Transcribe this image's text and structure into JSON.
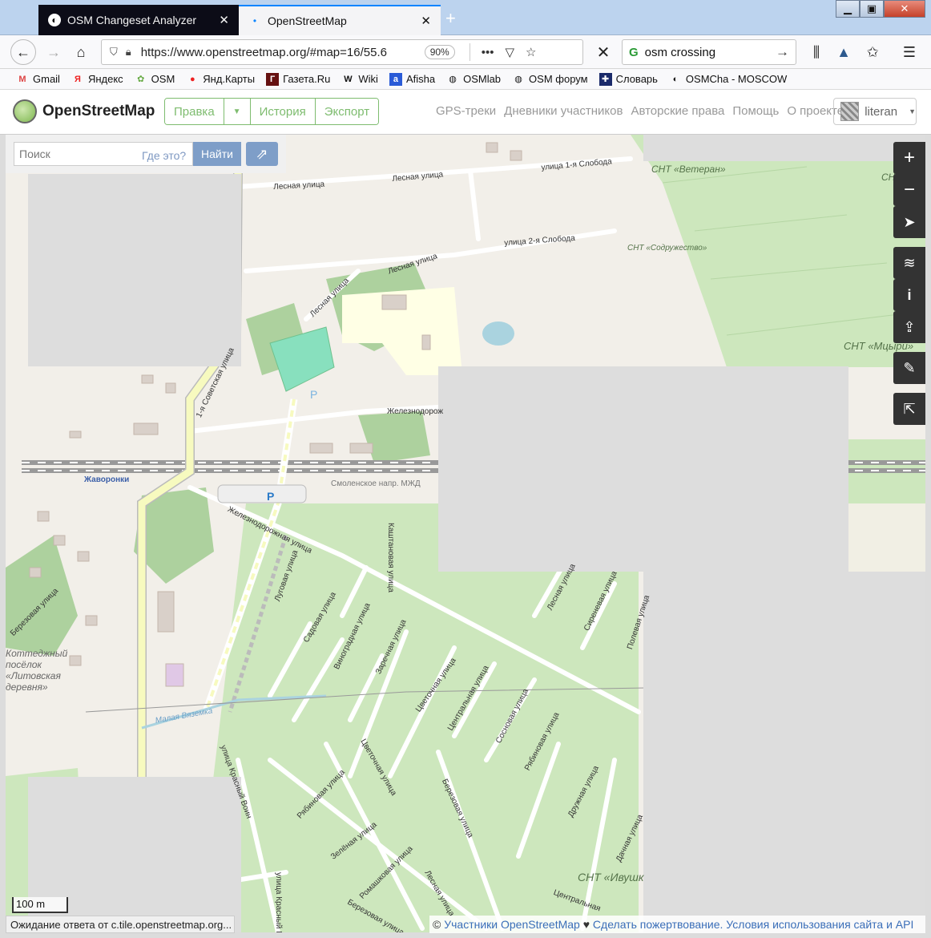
{
  "browser": {
    "tabs": [
      {
        "title": "OSM Changeset Analyzer",
        "active": false
      },
      {
        "title": "OpenStreetMap",
        "active": true
      }
    ],
    "new_tab_symbol": "+",
    "url": "https://www.openstreetmap.org/#map=16/55.6",
    "zoom": "90%",
    "search_query": "osm crossing",
    "bookmarks": [
      "Gmail",
      "Яндекс",
      "OSM",
      "Янд.Карты",
      "Газета.Ru",
      "Wiki",
      "Afisha",
      "OSMlab",
      "OSM форум",
      "Словарь",
      "OSMCha - MOSCOW"
    ]
  },
  "osm": {
    "site_name": "OpenStreetMap",
    "edit_label": "Правка",
    "history_label": "История",
    "export_label": "Экспорт",
    "nav_links": [
      "GPS-треки",
      "Дневники участников",
      "Авторские права",
      "Помощь",
      "О проекте"
    ],
    "username": "literan",
    "search_placeholder": "Поиск",
    "where_is": "Где это?",
    "find_button": "Найти"
  },
  "map": {
    "labels": {
      "lesnaya1": "Лесная улица",
      "lesnaya2": "Лесная улица",
      "lesnaya3": "Лесная улица",
      "lesnaya4": "Лесная улица",
      "sloboda1": "улица 1-я Слобода",
      "sloboda2": "улица 2-я Слобода",
      "snt_veteran": "СНТ «Ветеран»",
      "snt_yu": "СНТ «Юб",
      "snt_sodr": "СНТ «Содружество»",
      "snt_mtsyri": "СНТ «Мцыри»",
      "sovetskaya": "1-я Советская улица",
      "zheleznodor1": "Железнодорож",
      "zheleznodor2": "Железнодорожная улица",
      "zhavoronki": "Жаворонки",
      "mzhd": "Смоленское напр. МЖД",
      "kashtanovaya": "Каштановая улица",
      "lugovaya": "Луговая улица",
      "sadovaya": "Садовая улица",
      "vinogradnaya": "Виноградная улица",
      "zarechnaya": "Заречная улица",
      "tsvetochnaya1": "Цветочная улица",
      "tsvetochnaya2": "Цветочная улица",
      "tsentralnaya1": "Центральная улица",
      "tsentralnaya2": "Центральная",
      "sosnovaya": "Сосновая улица",
      "ryabinovaya1": "Рябиновая улица",
      "ryabinovaya2": "Рябиновая улица",
      "sirenevaya": "Сиреневая улица",
      "polevaya": "Полевая улица",
      "druzhnaya": "Дружная улица",
      "dachnaya": "Дачная улица",
      "berezovaya1": "Березовая улица",
      "berezovaya2": "Березовая улица",
      "berezovaya3": "Березовая улица",
      "zelenaya": "Зелёная улица",
      "romashkovaya": "Ромашковая улица",
      "krasny_voin": "улица Красный Воин",
      "krasny2": "улица Красный В",
      "cottage": "Коттеджный\nпосёлок\n«Литовская\nдеревня»",
      "molaya": "Малая Вяземка",
      "snt_ivushka": "СНТ «Ивушк"
    },
    "parking_symbol": "P",
    "scale": "100 m",
    "status": "Ожидание ответа от c.tile.openstreetmap.org...",
    "attribution_prefix": "©",
    "attribution_contributors": "Участники OpenStreetMap",
    "attribution_heart": "♥",
    "attribution_donate": "Сделать пожертвование.",
    "attribution_terms": "Условия использования сайта и API"
  },
  "colors": {
    "brand_green": "#7ebc6f",
    "link_blue": "#3a6eb8",
    "button_blue": "#7e9ec8",
    "garden_green": "#cde7bd",
    "forest_green": "#add19e",
    "road_yellow": "#f7fabf"
  }
}
